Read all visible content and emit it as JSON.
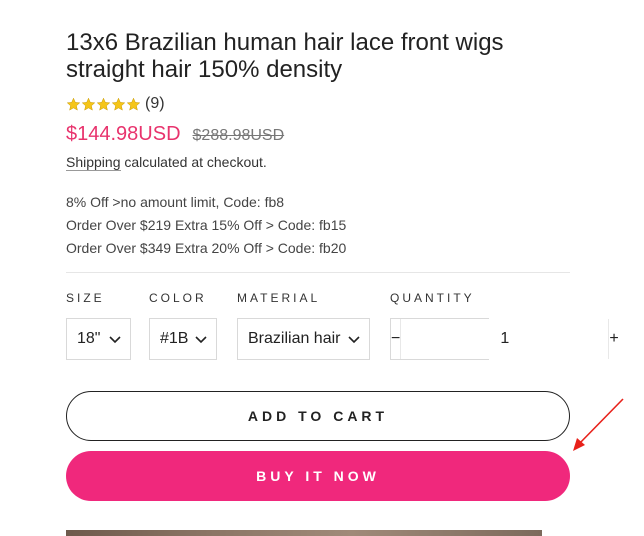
{
  "product": {
    "title": "13x6 Brazilian human hair lace front wigs straight hair 150% density",
    "rating": {
      "stars": 5,
      "review_count": "(9)",
      "star_color": "#f5c518"
    },
    "price": {
      "sale": "$144.98USD",
      "compare_at": "$288.98USD",
      "sale_color": "#e8336d"
    },
    "shipping": {
      "link_text": "Shipping",
      "rest_text": " calculated at checkout."
    },
    "promotions": [
      "8% Off >no amount limit, Code: fb8",
      "Order Over $219 Extra 15% Off > Code: fb15",
      "Order Over $349 Extra 20% Off > Code: fb20"
    ]
  },
  "options": {
    "size": {
      "label": "SIZE",
      "value": "18\""
    },
    "color": {
      "label": "COLOR",
      "value": "#1B"
    },
    "material": {
      "label": "MATERIAL",
      "value": "Brazilian hair"
    },
    "quantity": {
      "label": "QUANTITY",
      "value": "1",
      "minus": "−",
      "plus": "+"
    }
  },
  "actions": {
    "add_to_cart": "ADD TO CART",
    "buy_now": "BUY IT NOW",
    "buy_now_color": "#f0287c"
  },
  "annotation": {
    "arrow_color": "#e8211a"
  }
}
